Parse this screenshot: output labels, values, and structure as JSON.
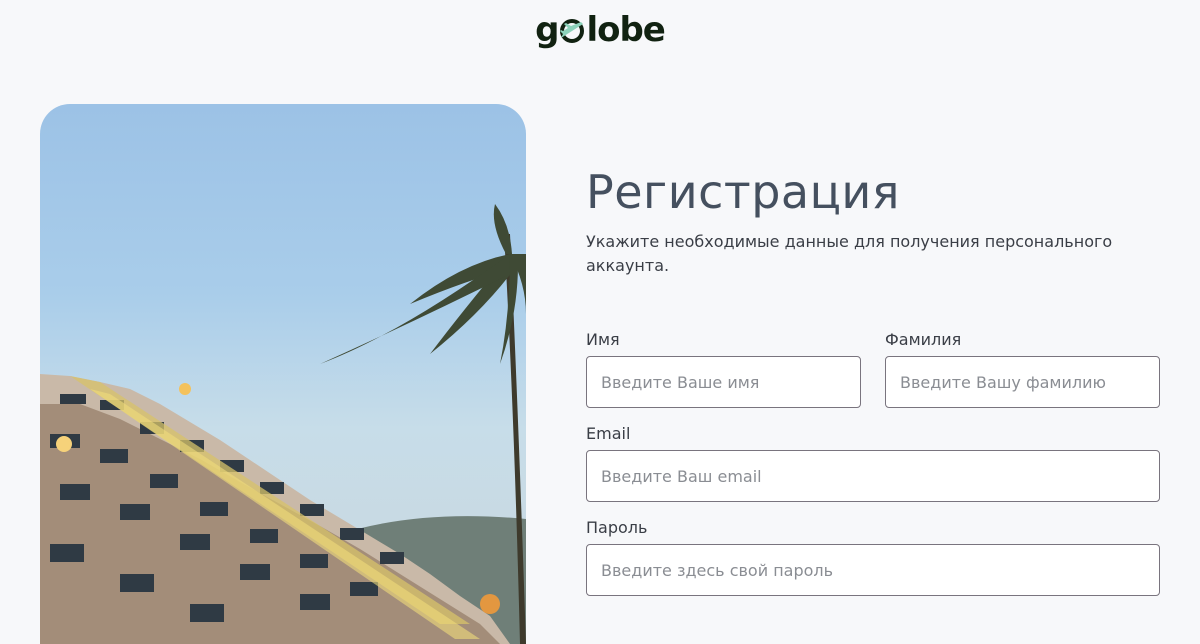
{
  "brand": {
    "logo_prefix": "g",
    "logo_suffix": "lobe",
    "logo_color": "#112211",
    "logo_accent": "#8dd3bb"
  },
  "page": {
    "title": "Регистрация",
    "subtitle": "Укажите необходимые данные для получения персонального аккаунта."
  },
  "form": {
    "first_name": {
      "label": "Имя",
      "placeholder": "Введите Ваше имя",
      "value": ""
    },
    "last_name": {
      "label": "Фамилия",
      "placeholder": "Введите Вашу фамилию",
      "value": ""
    },
    "email": {
      "label": "Email",
      "placeholder": "Введите Ваш email",
      "value": ""
    },
    "password": {
      "label": "Пароль",
      "placeholder": "Введите здесь свой пароль",
      "value": ""
    }
  }
}
